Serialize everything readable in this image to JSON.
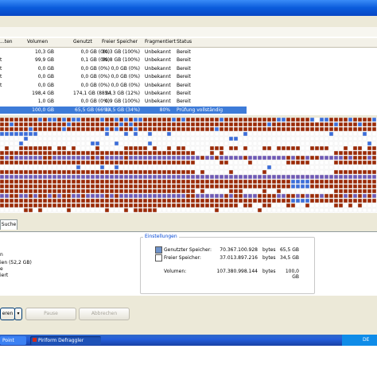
{
  "list": {
    "columns": [
      "...ten",
      "Volumen",
      "Genutzt",
      "Freier Speicher",
      "Fragmentiert",
      "Status"
    ],
    "rows": [
      {
        "name": "",
        "volume": "10,3 GB",
        "used": "0,0 GB (0%)",
        "free": "10,3 GB (100%)",
        "frag": "Unbekannt",
        "status": "Bereit",
        "selected": false
      },
      {
        "name": "t",
        "volume": "99,9 GB",
        "used": "0,1 GB (0%)",
        "free": "99,8 GB (100%)",
        "frag": "Unbekannt",
        "status": "Bereit",
        "selected": false
      },
      {
        "name": "t",
        "volume": "0,0 GB",
        "used": "0,0 GB (0%)",
        "free": "0,0 GB (0%)",
        "frag": "Unbekannt",
        "status": "Bereit",
        "selected": false
      },
      {
        "name": "t",
        "volume": "0,0 GB",
        "used": "0,0 GB (0%)",
        "free": "0,0 GB (0%)",
        "frag": "Unbekannt",
        "status": "Bereit",
        "selected": false
      },
      {
        "name": "t",
        "volume": "0,0 GB",
        "used": "0,0 GB (0%)",
        "free": "0,0 GB (0%)",
        "frag": "Unbekannt",
        "status": "Bereit",
        "selected": false
      },
      {
        "name": "",
        "volume": "198,4 GB",
        "used": "174,1 GB (88%)",
        "free": "24,3 GB (12%)",
        "frag": "Unbekannt",
        "status": "Bereit",
        "selected": false
      },
      {
        "name": "",
        "volume": "1,0 GB",
        "used": "0,0 GB (0%)",
        "free": "0,9 GB (100%)",
        "frag": "Unbekannt",
        "status": "Bereit",
        "selected": false
      },
      {
        "name": "",
        "volume": "100,0 GB",
        "used": "65,5 GB (66%)",
        "free": "34,5 GB (34%)",
        "frag": "80%",
        "status": "Prüfung vollständig",
        "selected": true
      }
    ]
  },
  "tabs": {
    "search_label": "Suche"
  },
  "details": {
    "left_lines": [
      "n",
      "",
      "ien (52,2 GB)",
      "e",
      "iert"
    ]
  },
  "settings": {
    "title": "Einstellungen",
    "used_label": "Genutzter Speicher:",
    "used_bytes": "70.367.100.928",
    "used_unit": "bytes",
    "used_gb": "65,5 GB",
    "free_label": "Freier Speicher:",
    "free_bytes": "37.013.897.216",
    "free_unit": "bytes",
    "free_gb": "34,5 GB",
    "volume_label": "Volumen:",
    "volume_bytes": "107.380.998.144",
    "volume_unit": "bytes",
    "volume_gb": "100,0 GB"
  },
  "buttons": {
    "defrag": "eren",
    "pause": "Pause",
    "cancel": "Abbrechen"
  },
  "taskbar": {
    "item1": "Point",
    "item2": "Piriform Defraggler",
    "lang": "DE"
  },
  "colors": {
    "used_block": "#9b2a07",
    "free_block": "#ffffff",
    "blue_block": "#3b6dd9",
    "purple_block": "#6f59b5",
    "selected": "#3d7bd8"
  }
}
